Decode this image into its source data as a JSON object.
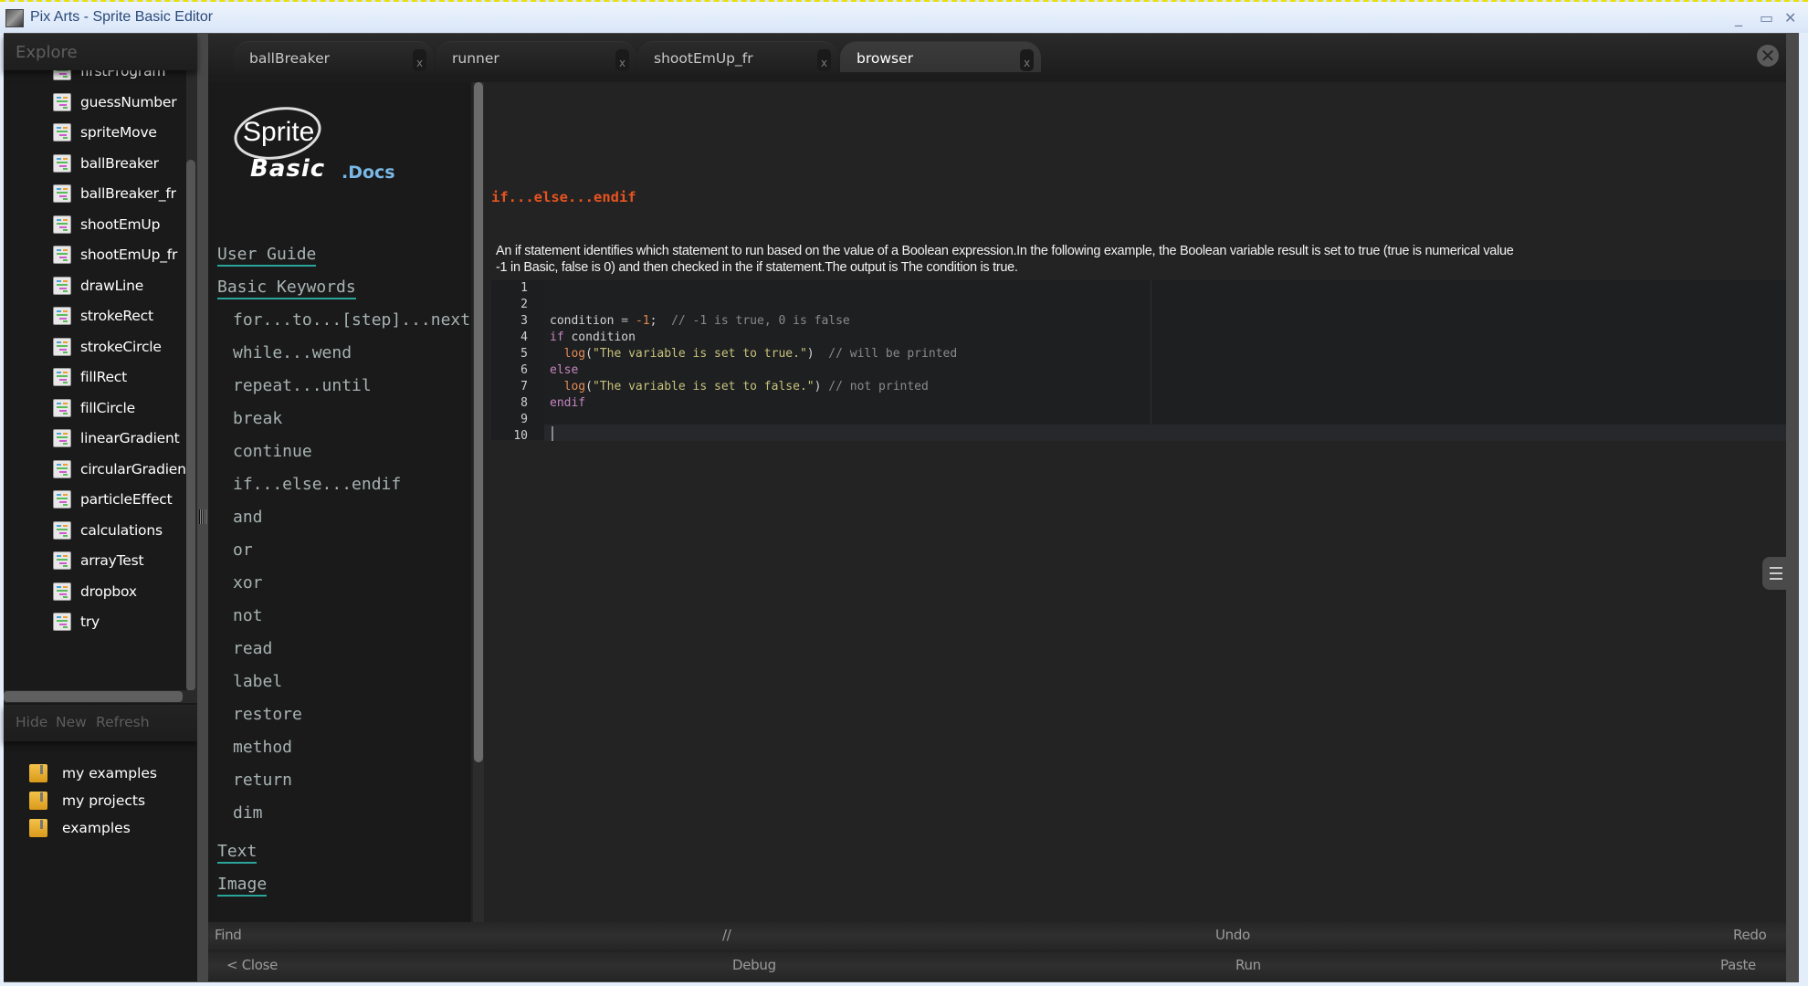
{
  "window": {
    "title": "Pix Arts - Sprite Basic Editor",
    "minimize_glyph": "_",
    "maximize_glyph": "▭",
    "close_glyph": "✕"
  },
  "sidebar": {
    "header": "Explore",
    "files": [
      {
        "label": "firstProgram",
        "icon": "basic-file-icon"
      },
      {
        "label": "guessNumber",
        "icon": "basic-file-icon"
      },
      {
        "label": "spriteMove",
        "icon": "basic-file-icon"
      },
      {
        "label": "ballBreaker",
        "icon": "basic-file-icon"
      },
      {
        "label": "ballBreaker_fr",
        "icon": "basic-file-icon"
      },
      {
        "label": "shootEmUp",
        "icon": "basic-file-icon"
      },
      {
        "label": "shootEmUp_fr",
        "icon": "basic-file-icon"
      },
      {
        "label": "drawLine",
        "icon": "basic-file-icon"
      },
      {
        "label": "strokeRect",
        "icon": "basic-file-icon"
      },
      {
        "label": "strokeCircle",
        "icon": "basic-file-icon"
      },
      {
        "label": "fillRect",
        "icon": "basic-file-icon"
      },
      {
        "label": "fillCircle",
        "icon": "basic-file-icon"
      },
      {
        "label": "linearGradient",
        "icon": "basic-file-icon"
      },
      {
        "label": "circularGradient",
        "icon": "basic-file-icon"
      },
      {
        "label": "particleEffect",
        "icon": "basic-file-icon"
      },
      {
        "label": "calculations",
        "icon": "basic-file-icon"
      },
      {
        "label": "arrayTest",
        "icon": "basic-file-icon"
      },
      {
        "label": "dropbox",
        "icon": "basic-file-icon"
      },
      {
        "label": "try",
        "icon": "basic-file-icon"
      }
    ],
    "actions": {
      "hide": "Hide",
      "new": "New",
      "refresh": "Refresh"
    },
    "folders": [
      {
        "label": "my examples",
        "icon": "archive-folder-icon"
      },
      {
        "label": "my projects",
        "icon": "archive-folder-icon"
      },
      {
        "label": "examples",
        "icon": "archive-folder-icon"
      }
    ]
  },
  "tabs": [
    {
      "label": "ballBreaker",
      "close": "x",
      "active": false
    },
    {
      "label": "runner",
      "close": "x",
      "active": false
    },
    {
      "label": "shootEmUp_fr",
      "close": "x",
      "active": false
    },
    {
      "label": "browser",
      "close": "x",
      "active": true
    }
  ],
  "close_all_glyph": "✕",
  "docs": {
    "logo": {
      "sprite": "Sprite",
      "basic": "Basic",
      "docs": ".Docs"
    },
    "nav": [
      {
        "label": "User Guide",
        "level": "top"
      },
      {
        "label": "Basic Keywords",
        "level": "top"
      },
      {
        "label": "for...to...[step]...next",
        "level": "sub"
      },
      {
        "label": "while...wend",
        "level": "sub"
      },
      {
        "label": "repeat...until",
        "level": "sub"
      },
      {
        "label": "break",
        "level": "sub"
      },
      {
        "label": "continue",
        "level": "sub"
      },
      {
        "label": "if...else...endif",
        "level": "sub"
      },
      {
        "label": "and",
        "level": "sub"
      },
      {
        "label": "or",
        "level": "sub"
      },
      {
        "label": "xor",
        "level": "sub"
      },
      {
        "label": "not",
        "level": "sub"
      },
      {
        "label": "read",
        "level": "sub"
      },
      {
        "label": "label",
        "level": "sub"
      },
      {
        "label": "restore",
        "level": "sub"
      },
      {
        "label": "method",
        "level": "sub"
      },
      {
        "label": "return",
        "level": "sub"
      },
      {
        "label": "dim",
        "level": "sub"
      },
      {
        "label": "Text",
        "level": "top"
      },
      {
        "label": "Image",
        "level": "top"
      }
    ],
    "title": "if...else...endif",
    "description": "An if statement identifies which statement to run based on the value of a Boolean expression.In the following example, the Boolean variable result is set to true (true is numerical value -1 in Basic, false is 0) and then checked in the if statement.The output is The condition is true.",
    "code": {
      "line_numbers": [
        "1",
        "2",
        "3",
        "4",
        "5",
        "6",
        "7",
        "8",
        "9",
        "10"
      ],
      "lines": [
        [],
        [],
        [
          {
            "t": "condition ",
            "c": ""
          },
          {
            "t": "= ",
            "c": "op"
          },
          {
            "t": "-1",
            "c": "num"
          },
          {
            "t": ";  ",
            "c": ""
          },
          {
            "t": "// -1 is true, 0 is false",
            "c": "cmt"
          }
        ],
        [
          {
            "t": "if",
            "c": "kw"
          },
          {
            "t": " condition",
            "c": ""
          }
        ],
        [
          {
            "t": "  ",
            "c": ""
          },
          {
            "t": "log",
            "c": "fn"
          },
          {
            "t": "(",
            "c": ""
          },
          {
            "t": "\"The variable is set to true.\"",
            "c": "str"
          },
          {
            "t": ")  ",
            "c": ""
          },
          {
            "t": "// will be printed",
            "c": "cmt"
          }
        ],
        [
          {
            "t": "else",
            "c": "kw"
          }
        ],
        [
          {
            "t": "  ",
            "c": ""
          },
          {
            "t": "log",
            "c": "fn"
          },
          {
            "t": "(",
            "c": ""
          },
          {
            "t": "\"The variable is set to false.\"",
            "c": "str"
          },
          {
            "t": ") ",
            "c": ""
          },
          {
            "t": "// not printed",
            "c": "cmt"
          }
        ],
        [
          {
            "t": "endif",
            "c": "kw"
          }
        ],
        [],
        []
      ]
    }
  },
  "toolbar_top": {
    "find": "Find",
    "comment": "//",
    "undo": "Undo",
    "redo": "Redo"
  },
  "toolbar_bottom": {
    "close": "< Close",
    "debug": "Debug",
    "run": "Run",
    "paste": "Paste"
  },
  "colors": {
    "keyword_title": "#e9531f",
    "link_underline": "#2aa59a",
    "docs_accent": "#79b8e6"
  }
}
